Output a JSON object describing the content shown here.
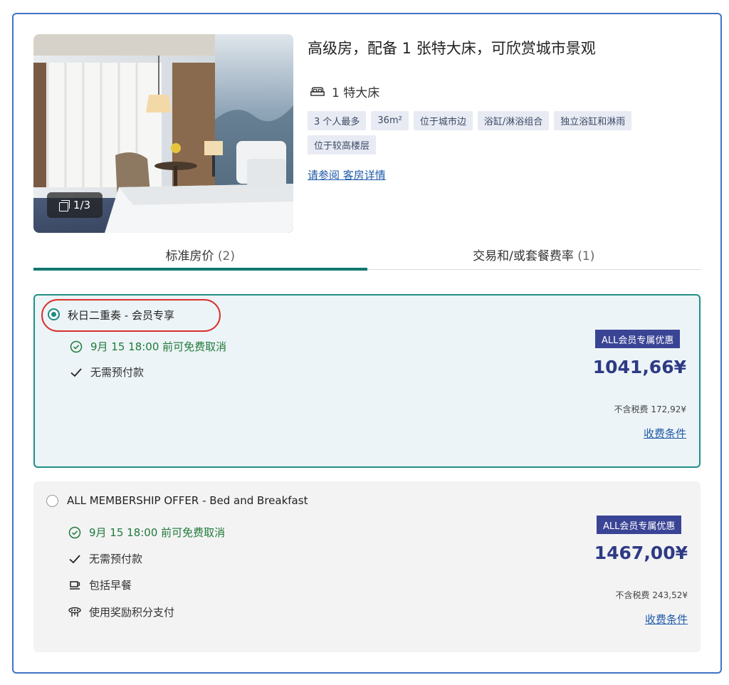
{
  "room": {
    "title": "高级房，配备 1 张特大床，可欣赏城市景观",
    "bed": "1 特大床",
    "tags": [
      "3 个人最多",
      "36m²",
      "位于城市边",
      "浴缸/淋浴组合",
      "独立浴缸和淋雨",
      "位于较高楼层"
    ],
    "details_link": "请参阅 客房详情",
    "photo_counter": "1/3"
  },
  "tabs": [
    {
      "label": "标准房价",
      "count": "(2)",
      "active": true
    },
    {
      "label": "交易和/或套餐费率",
      "count": "(1)",
      "active": false
    }
  ],
  "rates": [
    {
      "name": "秋日二重奏 - 会员专享",
      "selected": true,
      "features": [
        {
          "icon": "clock-icon",
          "text": "9月 15 18:00 前可免费取消",
          "green": true
        },
        {
          "icon": "check-icon",
          "text": "无需预付款",
          "green": false
        }
      ],
      "badge": "ALL会员专属优惠",
      "price": "1041,66¥",
      "tax": "不含税费 172,92¥",
      "terms": "收费条件"
    },
    {
      "name": "ALL MEMBERSHIP OFFER - Bed and Breakfast",
      "selected": false,
      "features": [
        {
          "icon": "clock-icon",
          "text": "9月 15 18:00 前可免费取消",
          "green": true
        },
        {
          "icon": "check-icon",
          "text": "无需预付款",
          "green": false
        },
        {
          "icon": "coffee-cup-icon",
          "text": "包括早餐",
          "green": false
        },
        {
          "icon": "reward-points-icon",
          "text": "使用奖励积分支付",
          "green": false
        }
      ],
      "badge": "ALL会员专属优惠",
      "price": "1467,00¥",
      "tax": "不含税费 243,52¥",
      "terms": "收费条件"
    }
  ],
  "colors": {
    "accent": "#11786f",
    "link": "#1f5aa8",
    "price": "#2e3a84",
    "badge": "#3a4495",
    "cancel_green": "#1f7a3a",
    "highlight": "#d9302c"
  }
}
